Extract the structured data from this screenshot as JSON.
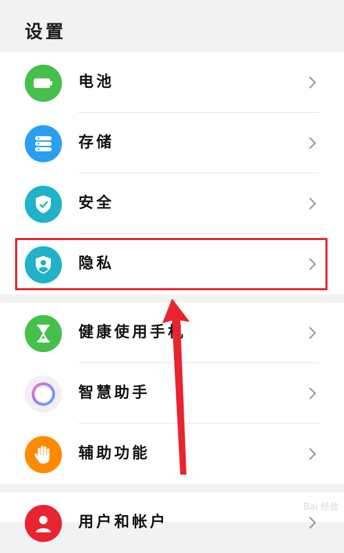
{
  "header": {
    "title": "设置"
  },
  "groups": [
    {
      "items": [
        {
          "label": "电池",
          "icon": "battery-icon",
          "color": "#45c04a"
        },
        {
          "label": "存储",
          "icon": "storage-icon",
          "color": "#2a9ff2"
        },
        {
          "label": "安全",
          "icon": "shield-check-icon",
          "color": "#20b2c8"
        },
        {
          "label": "隐私",
          "icon": "privacy-shield-icon",
          "color": "#20b2c8"
        }
      ]
    },
    {
      "items": [
        {
          "label": "健康使用手机",
          "icon": "hourglass-icon",
          "color": "#45c04a"
        },
        {
          "label": "智慧助手",
          "icon": "assistant-ring-icon",
          "color": "#b07cf5"
        },
        {
          "label": "辅助功能",
          "icon": "hand-icon",
          "color": "#ff8a00"
        }
      ]
    },
    {
      "items": [
        {
          "label": "用户和帐户",
          "icon": "user-icon",
          "color": "#e8242f"
        }
      ]
    }
  ],
  "annotation": {
    "highlight_color": "#e8242f",
    "arrow_color": "#e8242f"
  },
  "watermark": "Bai 经验"
}
